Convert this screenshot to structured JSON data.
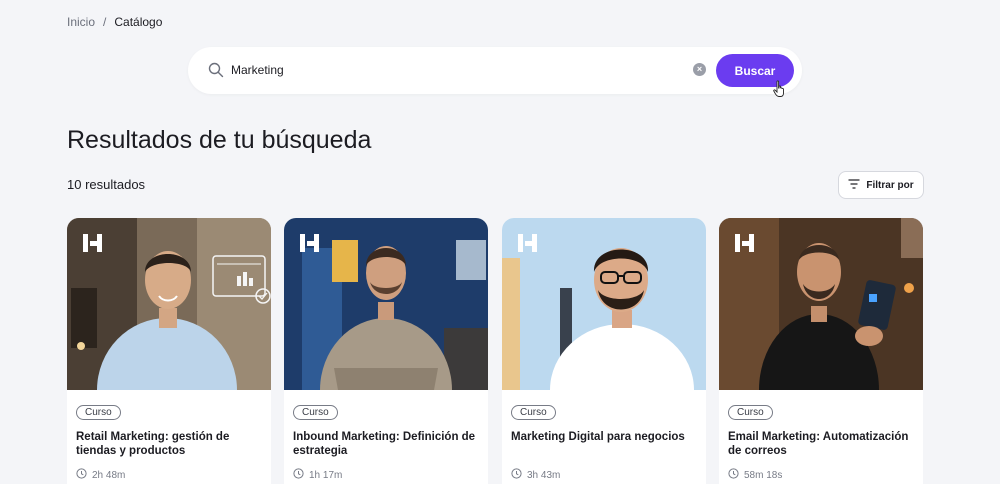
{
  "breadcrumb": {
    "home": "Inicio",
    "separator": "/",
    "current": "Catálogo"
  },
  "search": {
    "value": "Marketing",
    "button_label": "Buscar"
  },
  "page_title": "Resultados de tu búsqueda",
  "result_count": "10 resultados",
  "filter_label": "Filtrar por",
  "badge_label": "Curso",
  "colors": {
    "accent": "#6b3cf0",
    "background": "#f4f5f8"
  },
  "cards": [
    {
      "title": "Retail Marketing: gestión de tiendas y productos",
      "duration": "2h 48m",
      "badge": "Curso"
    },
    {
      "title": "Inbound Marketing: Definición de estrategia",
      "duration": "1h 17m",
      "badge": "Curso"
    },
    {
      "title": "Marketing Digital para negocios",
      "duration": "3h 43m",
      "badge": "Curso"
    },
    {
      "title": "Email Marketing: Automatización de correos",
      "duration": "58m 18s",
      "badge": "Curso"
    }
  ]
}
